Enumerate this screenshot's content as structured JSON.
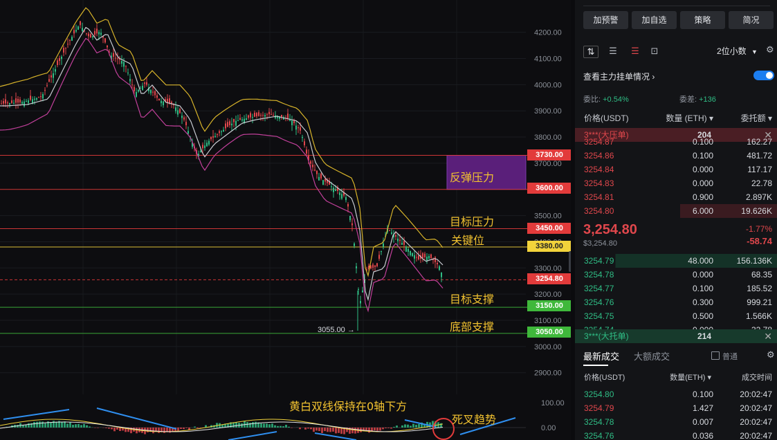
{
  "chart": {
    "price_axis": [
      "4200.00",
      "4100.00",
      "4000.00",
      "3900.00",
      "3800.00",
      "3700.00",
      "3500.00",
      "3400.00",
      "3300.00",
      "3200.00",
      "3100.00",
      "3000.00",
      "2900.00"
    ],
    "indicator_axis": [
      "100.00",
      "0.00"
    ],
    "levels": [
      {
        "value": "3730.00",
        "color": "#e23b3b"
      },
      {
        "value": "3600.00",
        "color": "#e23b3b"
      },
      {
        "value": "3450.00",
        "color": "#e23b3b"
      },
      {
        "value": "3380.00",
        "color": "#f2d33b"
      },
      {
        "value": "3254.80",
        "color": "#e23b3b"
      },
      {
        "value": "3150.00",
        "color": "#3fb83b"
      },
      {
        "value": "3050.00",
        "color": "#3fb83b"
      }
    ],
    "low_label": "3055.00 →",
    "annotations": {
      "rebound": "反弹压力",
      "target_pressure": "目标压力",
      "key_level": "关键位",
      "target_support": "目标支撑",
      "bottom_support": "底部支撑",
      "macd_note": "黄白双线保持在0轴下方",
      "death_cross": "死叉趋势"
    },
    "colors": {
      "up": "#2fbd85",
      "down": "#e0474c",
      "zone": "#5a1f7a",
      "zone_border": "#7c3aa8"
    }
  },
  "sidebar": {
    "buttons": [
      "加预警",
      "加自选",
      "策略",
      "简况"
    ],
    "decimal_select": "2位小数",
    "main_orders_link": "查看主力挂单情况",
    "main_orders_toggle": true,
    "ratio_label": "委比:",
    "ratio_value": "+0.54%",
    "diff_label": "委差:",
    "diff_value": "+136",
    "book_headers": {
      "price": "价格(USDT)",
      "qty": "数量 (ETH)",
      "total": "委托额"
    },
    "ask_banner": {
      "label": "3***(大压单)",
      "value": "204"
    },
    "asks": [
      {
        "price": "3254.87",
        "qty": "0.100",
        "total": "162.27"
      },
      {
        "price": "3254.86",
        "qty": "0.100",
        "total": "481.72"
      },
      {
        "price": "3254.84",
        "qty": "0.000",
        "total": "117.17"
      },
      {
        "price": "3254.83",
        "qty": "0.000",
        "total": "22.78"
      },
      {
        "price": "3254.81",
        "qty": "0.900",
        "total": "2.897K"
      },
      {
        "price": "3254.80",
        "qty": "6.000",
        "total": "19.626K"
      }
    ],
    "last_price": "3,254.80",
    "last_price_sub": "$3,254.80",
    "change_pct": "-1.77%",
    "change_abs": "-58.74",
    "bids": [
      {
        "price": "3254.79",
        "qty": "48.000",
        "total": "156.136K"
      },
      {
        "price": "3254.78",
        "qty": "0.000",
        "total": "68.35"
      },
      {
        "price": "3254.77",
        "qty": "0.100",
        "total": "185.52"
      },
      {
        "price": "3254.76",
        "qty": "0.300",
        "total": "999.21"
      },
      {
        "price": "3254.75",
        "qty": "0.500",
        "total": "1.566K"
      },
      {
        "price": "3254.74",
        "qty": "0.000",
        "total": "32.78"
      }
    ],
    "bid_banner": {
      "label": "3***(大托单)",
      "value": "214"
    },
    "trade_tabs": [
      "最新成交",
      "大额成交"
    ],
    "normal_label": "普通",
    "trade_headers": {
      "price": "价格(USDT)",
      "qty": "数量(ETH)",
      "time": "成交时间"
    },
    "trades": [
      {
        "price": "3254.80",
        "qty": "0.100",
        "time": "20:02:47",
        "side": "buy"
      },
      {
        "price": "3254.79",
        "qty": "1.427",
        "time": "20:02:47",
        "side": "sell"
      },
      {
        "price": "3254.78",
        "qty": "0.007",
        "time": "20:02:47",
        "side": "buy"
      },
      {
        "price": "3254.76",
        "qty": "0.036",
        "time": "20:02:47",
        "side": "buy"
      }
    ]
  }
}
